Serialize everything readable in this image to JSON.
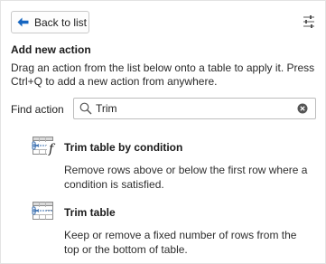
{
  "header": {
    "back_label": "Back to list"
  },
  "section": {
    "heading": "Add new action",
    "description": "Drag an action from the list below onto a table to apply it. Press Ctrl+Q to add a new action from anywhere."
  },
  "search": {
    "label": "Find action",
    "value": "Trim"
  },
  "results": [
    {
      "title": "Trim table by condition",
      "description": "Remove rows above or below the first row where a condition is satisfied."
    },
    {
      "title": "Trim table",
      "description": "Keep or remove a fixed number of rows from the top or the bottom of table."
    }
  ],
  "colors": {
    "accent": "#1565c0",
    "scissors": "#3a6fb0"
  }
}
